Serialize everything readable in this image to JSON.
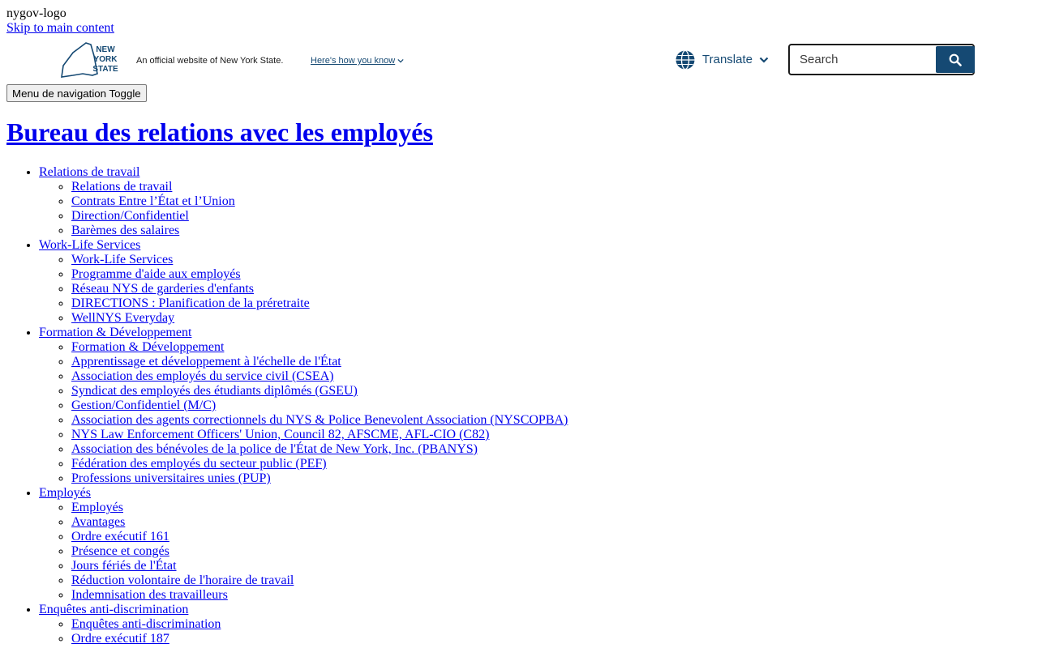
{
  "logo_alt": "nygov-logo",
  "skip_link": "Skip to main content",
  "nys_bar": {
    "official_text": "An official website of New York State.",
    "how_know": "Here's how you know",
    "translate": "Translate",
    "search_placeholder": "Search"
  },
  "menu_toggle": "Menu de navigation Toggle",
  "page_title": "Bureau des relations avec les employés",
  "nav": [
    {
      "label": "Relations de travail",
      "children": [
        "Relations de travail",
        "Contrats Entre l’État et l’Union",
        "Direction/Confidentiel",
        "Barèmes des salaires"
      ]
    },
    {
      "label": "Work-Life Services",
      "children": [
        "Work-Life Services",
        "Programme d'aide aux employés",
        "Réseau NYS de garderies d'enfants",
        "DIRECTIONS : Planification de la préretraite",
        "WellNYS Everyday"
      ]
    },
    {
      "label": "Formation & Développement",
      "children": [
        "Formation & Développement",
        "Apprentissage et développement à l'échelle de l'État",
        "Association des employés du service civil (CSEA)",
        "Syndicat des employés des étudiants diplômés (GSEU)",
        "Gestion/Confidentiel (M/C)",
        "Association des agents correctionnels du NYS & Police Benevolent Association (NYSCOPBA)",
        "NYS Law Enforcement Officers' Union, Council 82, AFSCME, AFL-CIO (C82)",
        "Association des bénévoles de la police de l'État de New York, Inc. (PBANYS)",
        "Fédération des employés du secteur public (PEF)",
        "Professions universitaires unies (PUP)"
      ]
    },
    {
      "label": "Employés",
      "children": [
        "Employés",
        "Avantages",
        "Ordre exécutif 161",
        "Présence et congés",
        "Jours fériés de l'État",
        "Réduction volontaire de l'horaire de travail",
        "Indemnisation des travailleurs"
      ]
    },
    {
      "label": "Enquêtes anti-discrimination",
      "children": [
        "Enquêtes anti-discrimination",
        "Ordre exécutif 187"
      ]
    }
  ],
  "colors": {
    "link": "#0000ee",
    "nys_blue": "#154973"
  },
  "icons": {
    "globe": "globe-icon",
    "search": "search-icon",
    "chevron": "chevron-down-icon"
  }
}
